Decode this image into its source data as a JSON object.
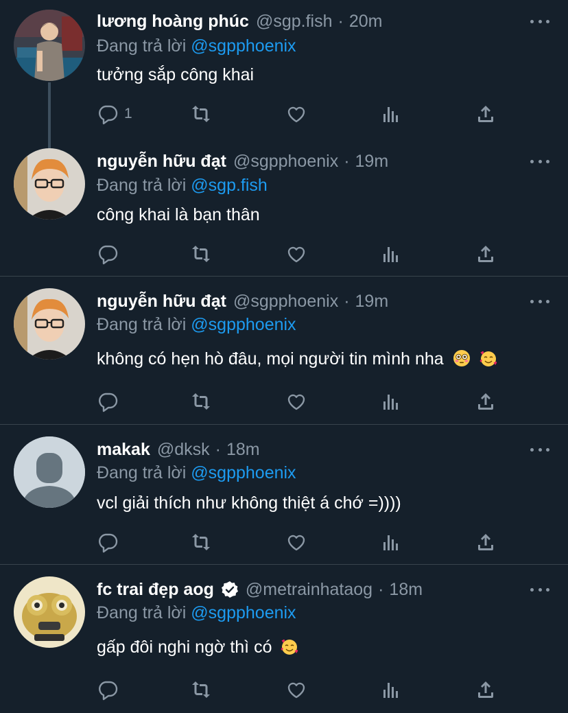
{
  "tweets": [
    {
      "name": "lương hoàng phúc",
      "handle": "@sgp.fish",
      "time": "20m",
      "replying_prefix": "Đang trả lời",
      "replying_to": "@sgpphoenix",
      "text": "tưởng sắp công khai",
      "reply_count": "1",
      "avatar": "photo-person-billiards",
      "verified": false
    },
    {
      "name": "nguyễn hữu đạt",
      "handle": "@sgpphoenix",
      "time": "19m",
      "replying_prefix": "Đang trả lời",
      "replying_to": "@sgp.fish",
      "text": "công khai là bạn thân",
      "reply_count": "",
      "avatar": "photo-orange-hair-glasses",
      "verified": false
    },
    {
      "name": "nguyễn hữu đạt",
      "handle": "@sgpphoenix",
      "time": "19m",
      "replying_prefix": "Đang trả lời",
      "replying_to": "@sgpphoenix",
      "text": "không có hẹn hò đâu, mọi người tin mình nha",
      "emojis": [
        "flushed-face",
        "smiling-face-with-hearts"
      ],
      "reply_count": "",
      "avatar": "photo-orange-hair-glasses",
      "verified": false
    },
    {
      "name": "makak",
      "handle": "@dksk",
      "time": "18m",
      "replying_prefix": "Đang trả lời",
      "replying_to": "@sgpphoenix",
      "text": "vcl giải thích như không thiệt á chớ =))))",
      "reply_count": "",
      "avatar": "default-avatar",
      "verified": false
    },
    {
      "name": "fc trai đẹp aog",
      "handle": "@metrainhataog",
      "time": "18m",
      "replying_prefix": "Đang trả lời",
      "replying_to": "@sgpphoenix",
      "text": "gấp đôi nghi ngờ thì có",
      "emojis": [
        "smiling-face-with-hearts"
      ],
      "reply_count": "",
      "avatar": "photo-cartoon-creature",
      "verified": true
    }
  ],
  "separator": "·",
  "icons": [
    "reply-icon",
    "retweet-icon",
    "like-icon",
    "analytics-icon",
    "share-icon",
    "more-icon",
    "verified-badge-icon"
  ],
  "colors": {
    "background": "#15202b",
    "divider": "#38444d",
    "secondary_text": "#8b98a5",
    "mention": "#1d9bf0"
  }
}
